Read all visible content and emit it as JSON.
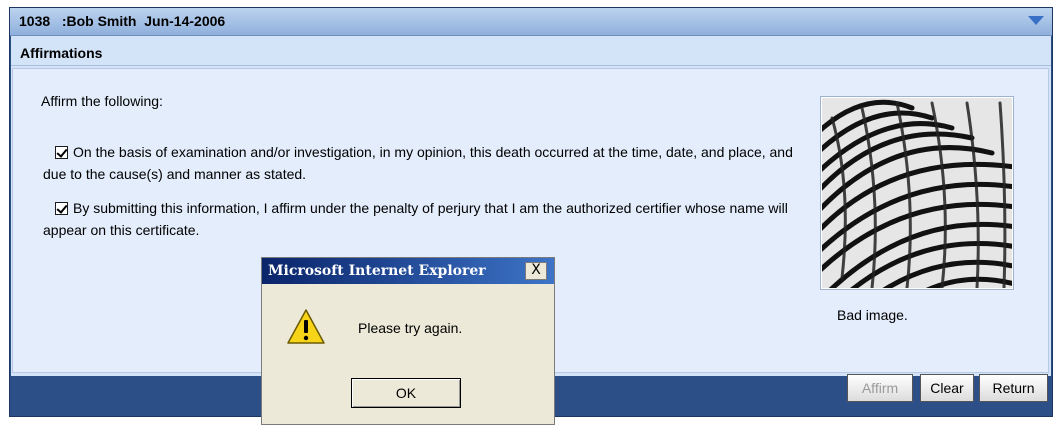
{
  "window": {
    "title": "1038   :Bob Smith  Jun-14-2006"
  },
  "section": {
    "heading": "Affirmations"
  },
  "affirmations": {
    "intro": "Affirm the following:",
    "items": [
      {
        "checked": true,
        "text": "On the basis of examination and/or investigation, in my opinion, this death occurred at the time, date, and place, and due to the cause(s) and manner as stated."
      },
      {
        "checked": true,
        "text": "By submitting this information, I affirm under the penalty of perjury that I am the authorized certifier whose name will appear on this certificate."
      }
    ]
  },
  "fingerprint": {
    "caption": "Bad image."
  },
  "buttons": {
    "affirm": "Affirm",
    "clear": "Clear",
    "return": "Return"
  },
  "dialog": {
    "title": "Microsoft Internet Explorer",
    "close": "X",
    "message": "Please try again.",
    "ok": "OK"
  },
  "colors": {
    "frame": "#2c4f88",
    "panel": "#d3e3f8",
    "content": "#e3edfb",
    "dialog_bg": "#ece9d8"
  },
  "icons": {
    "dialog": "warning-icon",
    "header": "chevron-down-icon"
  }
}
